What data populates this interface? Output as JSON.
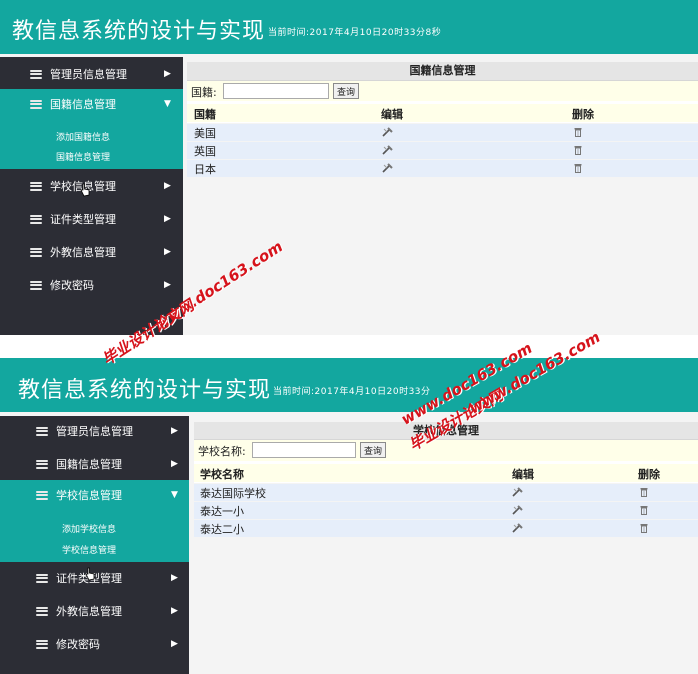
{
  "colors": {
    "accent": "#13a79f",
    "sidebar": "#2c2d35",
    "watermark": "#d6131b"
  },
  "screens": [
    {
      "title": "教信息系统的设计与实现",
      "time": "当前时间:2017年4月10日20时33分8秒",
      "nav": [
        {
          "label": "管理员信息管理",
          "icon": "stack-icon"
        },
        {
          "label": "国籍信息管理",
          "icon": "stack-icon",
          "active": true
        },
        {
          "label": "学校信息管理",
          "icon": "stack-icon"
        },
        {
          "label": "证件类型管理",
          "icon": "stack-icon"
        },
        {
          "label": "外教信息管理",
          "icon": "stack-icon"
        },
        {
          "label": "修改密码",
          "icon": "stack-icon"
        }
      ],
      "submenu": [
        "添加国籍信息",
        "国籍信息管理"
      ],
      "content": {
        "caption": "国籍信息管理",
        "search_label": "国籍:",
        "search_value": "",
        "search_button": "查询",
        "columns": [
          "国籍",
          "编辑",
          "删除"
        ],
        "rows": [
          [
            "美国"
          ],
          [
            "英国"
          ],
          [
            "日本"
          ]
        ]
      }
    },
    {
      "title": "教信息系统的设计与实现",
      "time": "当前时间:2017年4月10日20时33分",
      "nav": [
        {
          "label": "管理员信息管理",
          "icon": "stack-icon"
        },
        {
          "label": "国籍信息管理",
          "icon": "stack-icon"
        },
        {
          "label": "学校信息管理",
          "icon": "stack-icon",
          "active": true
        },
        {
          "label": "证件类型管理",
          "icon": "stack-icon"
        },
        {
          "label": "外教信息管理",
          "icon": "stack-icon"
        },
        {
          "label": "修改密码",
          "icon": "stack-icon"
        }
      ],
      "submenu": [
        "添加学校信息",
        "学校信息管理"
      ],
      "content": {
        "caption": "学校信息管理",
        "search_label": "学校名称:",
        "search_value": "",
        "search_button": "查询",
        "columns": [
          "学校名称",
          "编辑",
          "删除"
        ],
        "rows": [
          [
            "泰达国际学校"
          ],
          [
            "泰达一小"
          ],
          [
            "泰达二小"
          ]
        ]
      }
    }
  ],
  "watermarks": [
    {
      "text": "www.doc163.com"
    },
    {
      "text": "毕业设计论文网"
    },
    {
      "text": "www.doc163.com"
    },
    {
      "text": "毕业设计论文网"
    },
    {
      "text": "www.doc163.com"
    }
  ]
}
